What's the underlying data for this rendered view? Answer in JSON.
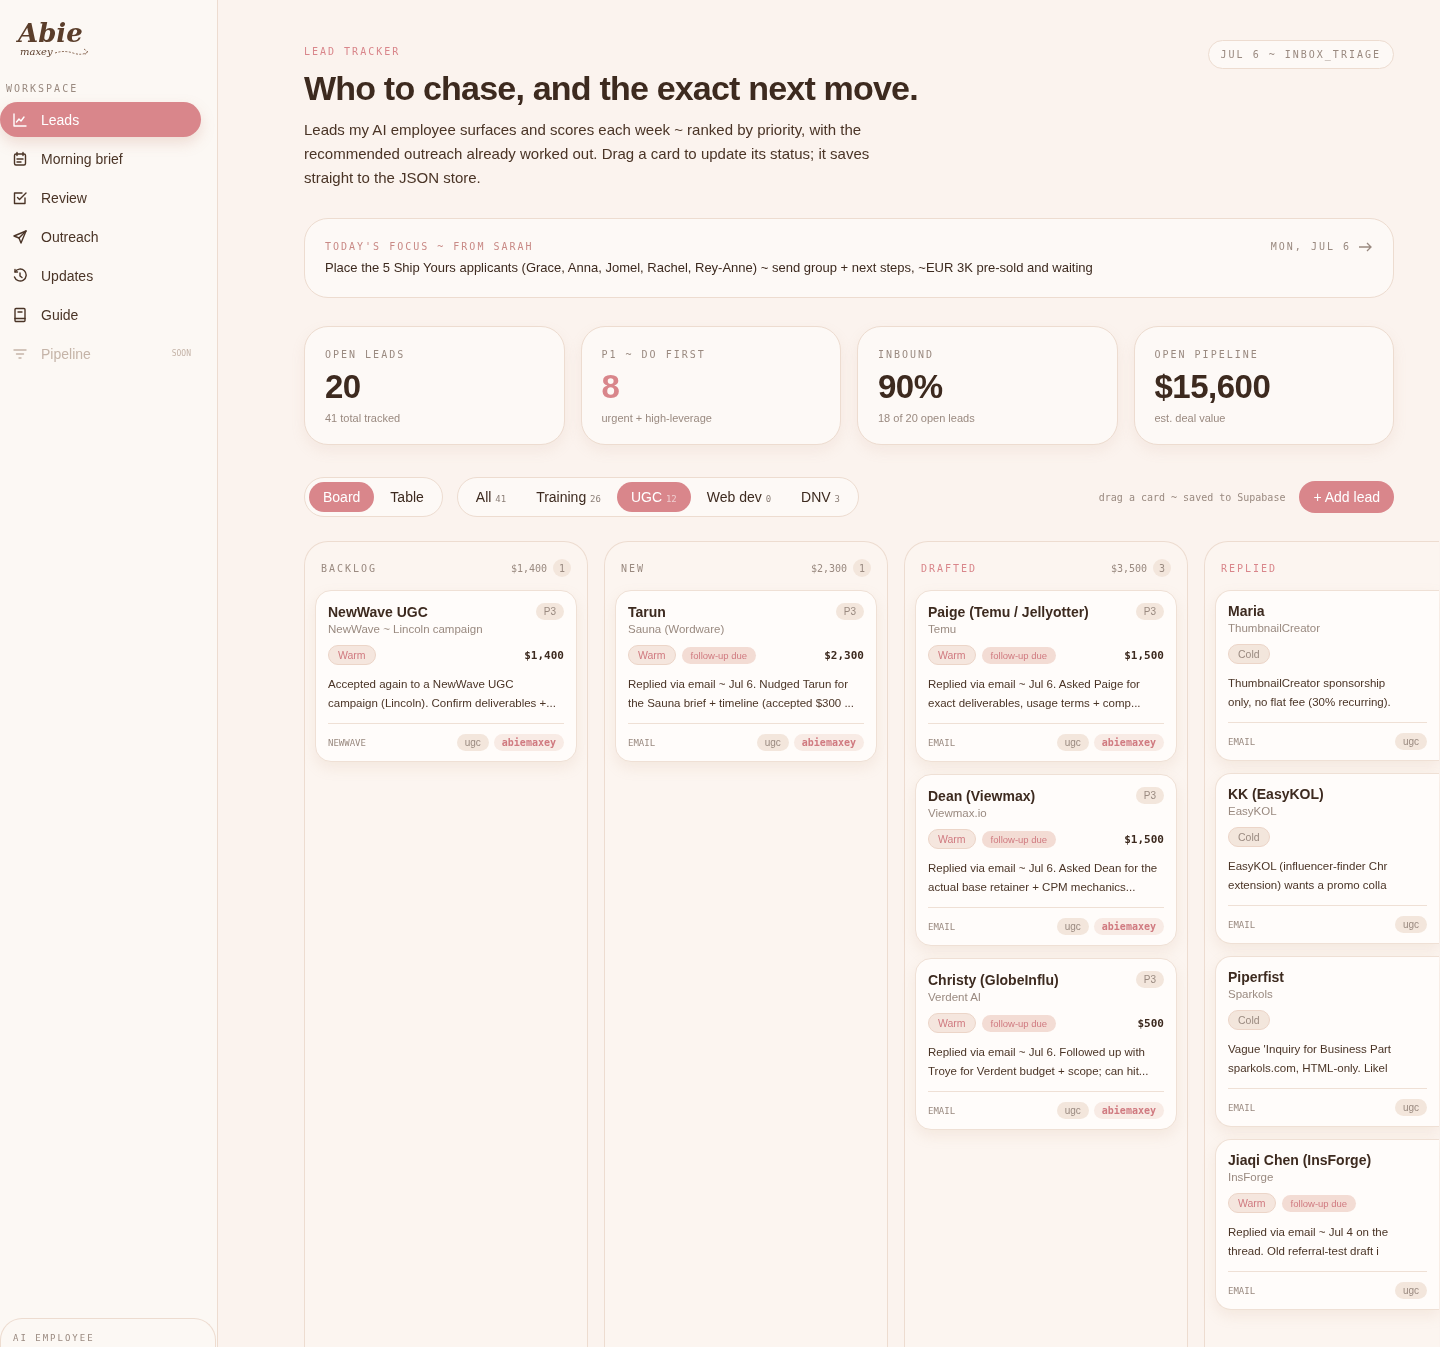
{
  "sidebar": {
    "logo": {
      "title": "Abie",
      "subtitle": "maxey"
    },
    "section_label": "WORKSPACE",
    "items": [
      {
        "label": "Leads",
        "selected": true,
        "disabled": false
      },
      {
        "label": "Morning brief",
        "selected": false,
        "disabled": false
      },
      {
        "label": "Review",
        "selected": false,
        "disabled": false
      },
      {
        "label": "Outreach",
        "selected": false,
        "disabled": false
      },
      {
        "label": "Updates",
        "selected": false,
        "disabled": false
      },
      {
        "label": "Guide",
        "selected": false,
        "disabled": false
      },
      {
        "label": "Pipeline",
        "selected": false,
        "disabled": true,
        "badge": "SOON"
      }
    ],
    "footer_card": {
      "label": "AI EMPLOYEE"
    }
  },
  "header": {
    "eyebrow": "LEAD TRACKER",
    "title": "Who to chase, and the exact next move.",
    "description": "Leads my AI employee surfaces and scores each week ~ ranked by priority, with the recommended outreach already worked out. Drag a card to update its status; it saves straight to the JSON store.",
    "badge": "JUL 6 ~ INBOX_TRIAGE"
  },
  "focus": {
    "label": "TODAY'S FOCUS ~ FROM SARAH",
    "date": "MON, JUL 6",
    "text": "Place the 5 Ship Yours applicants (Grace, Anna, Jomel, Rachel, Rey-Anne) ~ send group + next steps, ~EUR 3K pre-sold and waiting"
  },
  "stats": [
    {
      "label": "OPEN LEADS",
      "value": "20",
      "note": "41 total tracked",
      "highlight": false
    },
    {
      "label": "P1 ~ DO FIRST",
      "value": "8",
      "note": "urgent + high-leverage",
      "highlight": true
    },
    {
      "label": "INBOUND",
      "value": "90%",
      "note": "18 of 20 open leads",
      "highlight": false
    },
    {
      "label": "OPEN PIPELINE",
      "value": "$15,600",
      "note": "est. deal value",
      "highlight": false
    }
  ],
  "view_tabs": [
    {
      "label": "Board",
      "selected": true
    },
    {
      "label": "Table",
      "selected": false
    }
  ],
  "filters": [
    {
      "label": "All",
      "count": "41",
      "selected": false
    },
    {
      "label": "Training",
      "count": "26",
      "selected": false
    },
    {
      "label": "UGC",
      "count": "12",
      "selected": true
    },
    {
      "label": "Web dev",
      "count": "0",
      "selected": false
    },
    {
      "label": "DNV",
      "count": "3",
      "selected": false
    }
  ],
  "hint": "drag a card ~ saved to Supabase",
  "add_button": "+ Add lead",
  "columns": [
    {
      "title": "BACKLOG",
      "color": "#9a8a80",
      "total": "$1,400",
      "count": "1",
      "cards": [
        {
          "name": "NewWave UGC",
          "company": "NewWave ~ Lincoln campaign",
          "priority": "P3",
          "amount": "$1,400",
          "tags": [
            {
              "label": "Warm",
              "kind": "warm"
            }
          ],
          "description": [
            "Accepted again to a NewWave UGC",
            "campaign (Lincoln). Confirm deliverables +..."
          ],
          "source": "NEWWAVE",
          "chips": [
            {
              "label": "ugc",
              "kind": "topic"
            },
            {
              "label": "abiemaxey",
              "kind": "owner"
            }
          ]
        }
      ]
    },
    {
      "title": "NEW",
      "color": "#9a8a80",
      "total": "$2,300",
      "count": "1",
      "cards": [
        {
          "name": "Tarun",
          "company": "Sauna (Wordware)",
          "priority": "P3",
          "amount": "$2,300",
          "tags": [
            {
              "label": "Warm",
              "kind": "warm"
            },
            {
              "label": "follow-up due",
              "kind": "due"
            }
          ],
          "description": [
            "Replied via email ~ Jul 6. Nudged Tarun for",
            "the Sauna brief + timeline (accepted $300 ..."
          ],
          "source": "EMAIL",
          "chips": [
            {
              "label": "ugc",
              "kind": "topic"
            },
            {
              "label": "abiemaxey",
              "kind": "owner"
            }
          ]
        }
      ]
    },
    {
      "title": "DRAFTED",
      "color": "#d9868b",
      "total": "$3,500",
      "count": "3",
      "cards": [
        {
          "name": "Paige (Temu / Jellyotter)",
          "company": "Temu",
          "priority": "P3",
          "amount": "$1,500",
          "tags": [
            {
              "label": "Warm",
              "kind": "warm"
            },
            {
              "label": "follow-up due",
              "kind": "due"
            }
          ],
          "description": [
            "Replied via email ~ Jul 6. Asked Paige for",
            "exact deliverables, usage terms + comp..."
          ],
          "source": "EMAIL",
          "chips": [
            {
              "label": "ugc",
              "kind": "topic"
            },
            {
              "label": "abiemaxey",
              "kind": "owner"
            }
          ]
        },
        {
          "name": "Dean (Viewmax)",
          "company": "Viewmax.io",
          "priority": "P3",
          "amount": "$1,500",
          "tags": [
            {
              "label": "Warm",
              "kind": "warm"
            },
            {
              "label": "follow-up due",
              "kind": "due"
            }
          ],
          "description": [
            "Replied via email ~ Jul 6. Asked Dean for the",
            "actual base retainer + CPM mechanics..."
          ],
          "source": "EMAIL",
          "chips": [
            {
              "label": "ugc",
              "kind": "topic"
            },
            {
              "label": "abiemaxey",
              "kind": "owner"
            }
          ]
        },
        {
          "name": "Christy (GlobeInflu)",
          "company": "Verdent AI",
          "priority": "P3",
          "amount": "$500",
          "tags": [
            {
              "label": "Warm",
              "kind": "warm"
            },
            {
              "label": "follow-up due",
              "kind": "due"
            }
          ],
          "description": [
            "Replied via email ~ Jul 6. Followed up with",
            "Troye for Verdent budget + scope; can hit..."
          ],
          "source": "EMAIL",
          "chips": [
            {
              "label": "ugc",
              "kind": "topic"
            },
            {
              "label": "abiemaxey",
              "kind": "owner"
            }
          ]
        }
      ]
    },
    {
      "title": "REPLIED",
      "color": "#d9868b",
      "cards": [
        {
          "name": "Maria",
          "company": "ThumbnailCreator",
          "tags": [
            {
              "label": "Cold",
              "kind": "cold"
            }
          ],
          "description": [
            "ThumbnailCreator sponsorship",
            "only, no flat fee (30% recurring)."
          ],
          "source": "EMAIL",
          "chips": [
            {
              "label": "ugc",
              "kind": "topic"
            }
          ]
        },
        {
          "name": "KK (EasyKOL)",
          "company": "EasyKOL",
          "tags": [
            {
              "label": "Cold",
              "kind": "cold"
            }
          ],
          "description": [
            "EasyKOL (influencer-finder Chr",
            "extension) wants a promo colla"
          ],
          "source": "EMAIL",
          "chips": [
            {
              "label": "ugc",
              "kind": "topic"
            }
          ]
        },
        {
          "name": "Piperfist",
          "company": "Sparkols",
          "tags": [
            {
              "label": "Cold",
              "kind": "cold"
            }
          ],
          "description": [
            "Vague 'Inquiry for Business Part",
            "sparkols.com, HTML-only. Likel"
          ],
          "source": "EMAIL",
          "chips": [
            {
              "label": "ugc",
              "kind": "topic"
            }
          ]
        },
        {
          "name": "Jiaqi Chen (InsForge)",
          "company": "InsForge",
          "tags": [
            {
              "label": "Warm",
              "kind": "warm"
            },
            {
              "label": "follow-up due",
              "kind": "due"
            }
          ],
          "description": [
            "Replied via email ~ Jul 4 on the",
            "thread. Old referral-test draft i"
          ],
          "source": "EMAIL",
          "chips": [
            {
              "label": "ugc",
              "kind": "topic"
            }
          ]
        }
      ]
    }
  ]
}
